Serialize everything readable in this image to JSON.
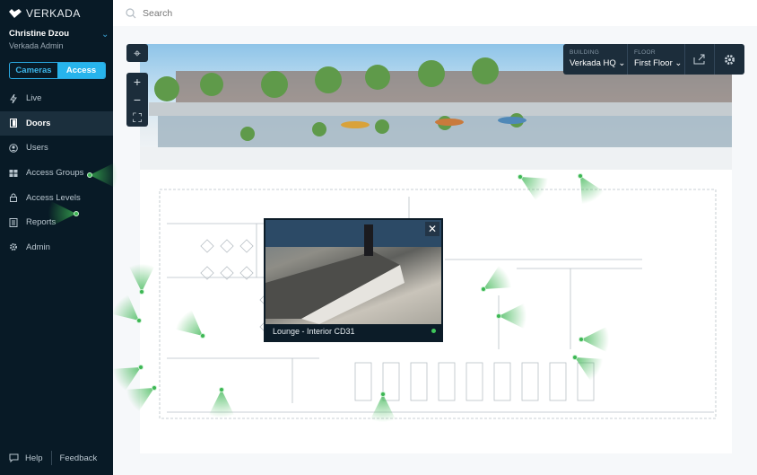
{
  "app": {
    "brand": "VERKADA"
  },
  "user": {
    "name": "Christine Dzou",
    "role": "Verkada Admin"
  },
  "mode_toggle": {
    "options": [
      "Cameras",
      "Access"
    ],
    "selected": "Access"
  },
  "sidebar": {
    "items": [
      {
        "label": "Live",
        "icon": "bolt-icon"
      },
      {
        "label": "Doors",
        "icon": "door-icon",
        "active": true
      },
      {
        "label": "Users",
        "icon": "user-circle-icon"
      },
      {
        "label": "Access Groups",
        "icon": "group-icon"
      },
      {
        "label": "Access Levels",
        "icon": "lock-icon"
      },
      {
        "label": "Reports",
        "icon": "report-icon"
      },
      {
        "label": "Admin",
        "icon": "gear-icon"
      }
    ]
  },
  "footer": {
    "help": "Help",
    "feedback": "Feedback"
  },
  "search": {
    "placeholder": "Search",
    "value": ""
  },
  "map": {
    "building_label": "BUILDING",
    "building_value": "Verkada HQ",
    "floor_label": "FLOOR",
    "floor_value": "First Floor",
    "controls": [
      "map-view",
      "zoom-in",
      "zoom-out",
      "fullscreen"
    ]
  },
  "camera_popup": {
    "title": "Lounge - Interior CD31",
    "status": "online"
  },
  "colors": {
    "sidebar_bg": "#081a26",
    "accent": "#27b4ec",
    "camera_green": "#3cb653"
  }
}
